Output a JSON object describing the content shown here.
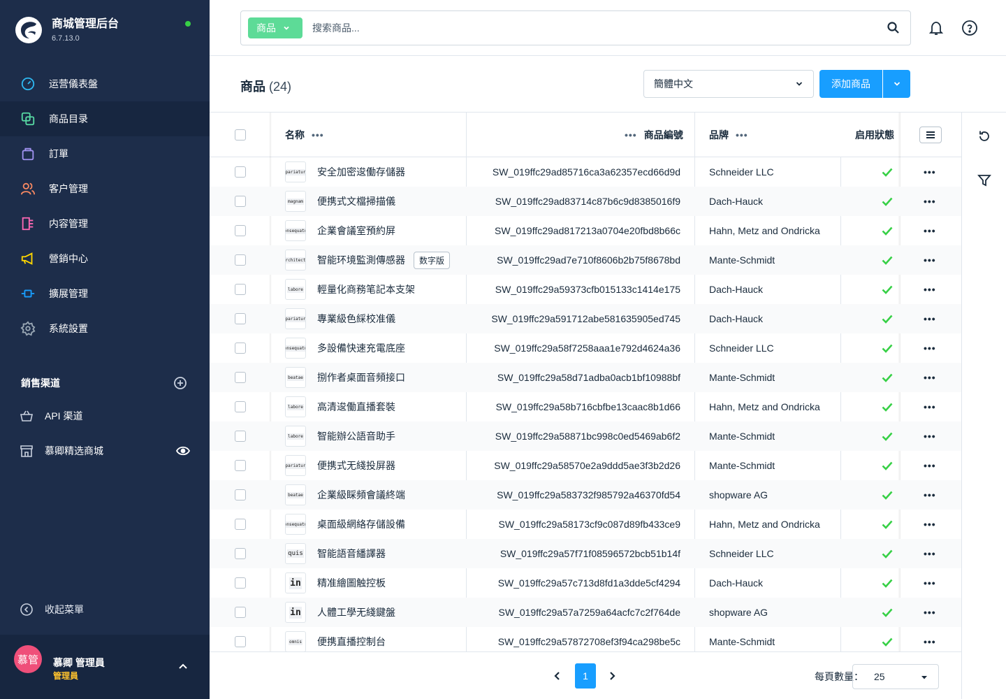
{
  "brand": {
    "title": "商城管理后台",
    "version": "6.7.13.0",
    "status_color": "#37d046"
  },
  "sidebar": {
    "items": [
      {
        "label": "运营儀表盤",
        "icon": "gauge-icon",
        "color": "#2eb7f0",
        "active": false
      },
      {
        "label": "商品目录",
        "icon": "products-icon",
        "color": "#57d9a3",
        "active": true
      },
      {
        "label": "訂單",
        "icon": "bag-icon",
        "color": "#a092f0",
        "active": false
      },
      {
        "label": "客户管理",
        "icon": "users-icon",
        "color": "#f88962",
        "active": false
      },
      {
        "label": "内容管理",
        "icon": "content-icon",
        "color": "#ff68b4",
        "active": false
      },
      {
        "label": "營銷中心",
        "icon": "megaphone-icon",
        "color": "#ffd700",
        "active": false
      },
      {
        "label": "擴展管理",
        "icon": "plug-icon",
        "color": "#189eff",
        "active": false
      },
      {
        "label": "系統設置",
        "icon": "gear-icon",
        "color": "#9aa8b5",
        "active": false
      }
    ],
    "channels_title": "銷售渠道",
    "channels": [
      {
        "label": "API 渠道",
        "icon": "basket-icon"
      },
      {
        "label": "慕卿精选商城",
        "icon": "storefront-icon"
      }
    ],
    "collapse_label": "收起菜單"
  },
  "user": {
    "initials": "慕管",
    "name": "慕卿 管理員",
    "role": "管理員"
  },
  "search": {
    "type_label": "商品",
    "placeholder": "搜索商品..."
  },
  "page": {
    "title": "商品",
    "count": "(24)"
  },
  "language": {
    "selected": "簡體中文"
  },
  "add_button": {
    "label": "添加商品"
  },
  "grid": {
    "columns": {
      "name": "名称",
      "number": "商品編號",
      "brand": "品牌",
      "active": "启用狀態"
    },
    "rows": [
      {
        "thumb": "pariatur",
        "name": "安全加密逡働存儲器",
        "number": "SW_019ffc29ad85716ca3a62357ecd66d9d",
        "brand": "Schneider LLC"
      },
      {
        "thumb": "magnam",
        "name": "便携式文檔掃描儀",
        "number": "SW_019ffc29ad83714c87b6c9d8385016f9",
        "brand": "Dach-Hauck"
      },
      {
        "thumb": "consequatur",
        "name": "企業會議室預約屏",
        "number": "SW_019ffc29ad817213a0704e20fbd8b66c",
        "brand": "Hahn, Metz and Ondricka"
      },
      {
        "thumb": "architecto",
        "name": "智能环境監測傳感器",
        "badge": "数字版",
        "number": "SW_019ffc29ad7e710f8606b2b75f8678bd",
        "brand": "Mante-Schmidt"
      },
      {
        "thumb": "labore",
        "name": "輕量化商務笔記本支架",
        "number": "SW_019ffc29a59373cfb015133c1414e175",
        "brand": "Dach-Hauck"
      },
      {
        "thumb": "pariatur",
        "name": "專業級色綵校准儀",
        "number": "SW_019ffc29a591712abe581635905ed745",
        "brand": "Dach-Hauck"
      },
      {
        "thumb": "consequatur",
        "name": "多設備快速充電底座",
        "number": "SW_019ffc29a58f7258aaa1e792d4624a36",
        "brand": "Schneider LLC"
      },
      {
        "thumb": "beatae",
        "name": "捌作者桌面音頻接口",
        "number": "SW_019ffc29a58d71adba0acb1bf10988bf",
        "brand": "Mante-Schmidt"
      },
      {
        "thumb": "labore",
        "name": "高清逡働直播套裝",
        "number": "SW_019ffc29a58b716cbfbe13caac8b1d66",
        "brand": "Hahn, Metz and Ondricka"
      },
      {
        "thumb": "labore",
        "name": "智能辦公語音助手",
        "number": "SW_019ffc29a58871bc998c0ed5469ab6f2",
        "brand": "Mante-Schmidt"
      },
      {
        "thumb": "pariatur",
        "name": "便携式无綫投屏器",
        "number": "SW_019ffc29a58570e2a9ddd5ae3f3b2d26",
        "brand": "Mante-Schmidt"
      },
      {
        "thumb": "beatae",
        "name": "企業級睬頻會議終端",
        "number": "SW_019ffc29a583732f985792a46370fd54",
        "brand": "shopware AG"
      },
      {
        "thumb": "consequatur",
        "name": "桌面級網絡存儲設備",
        "number": "SW_019ffc29a58173cf9c087d89fb433ce9",
        "brand": "Hahn, Metz and Ondricka"
      },
      {
        "thumb": "quis",
        "name": "智能語音繙譯器",
        "number": "SW_019ffc29a57f71f08596572bcb51b14f",
        "brand": "Schneider LLC"
      },
      {
        "thumb": "in",
        "name": "精准繪圖触控板",
        "number": "SW_019ffc29a57c713d8fd1a3dde5cf4294",
        "brand": "Dach-Hauck"
      },
      {
        "thumb": "in",
        "name": "人體工學无綫鍵盤",
        "number": "SW_019ffc29a57a7259a64acfc7c2f764de",
        "brand": "shopware AG"
      },
      {
        "thumb": "omnis",
        "name": "便携直播控制台",
        "number": "SW_019ffc29a57872708ef3f94ca298be5c",
        "brand": "Mante-Schmidt"
      }
    ]
  },
  "pagination": {
    "current": "1",
    "per_page_label": "每頁數量：",
    "per_page": "25"
  },
  "colors": {
    "accent": "#189eff",
    "success": "#37d046",
    "search_type": "#5ddb97",
    "sidebar": "#1d2d4a"
  }
}
